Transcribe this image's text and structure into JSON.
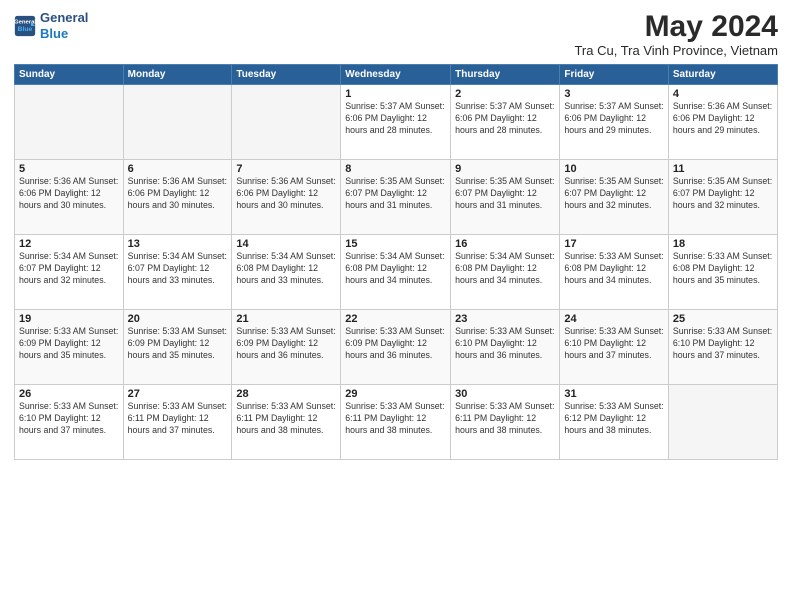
{
  "header": {
    "logo_line1": "General",
    "logo_line2": "Blue",
    "month_title": "May 2024",
    "subtitle": "Tra Cu, Tra Vinh Province, Vietnam"
  },
  "weekdays": [
    "Sunday",
    "Monday",
    "Tuesday",
    "Wednesday",
    "Thursday",
    "Friday",
    "Saturday"
  ],
  "weeks": [
    [
      {
        "day": "",
        "info": ""
      },
      {
        "day": "",
        "info": ""
      },
      {
        "day": "",
        "info": ""
      },
      {
        "day": "1",
        "info": "Sunrise: 5:37 AM\nSunset: 6:06 PM\nDaylight: 12 hours\nand 28 minutes."
      },
      {
        "day": "2",
        "info": "Sunrise: 5:37 AM\nSunset: 6:06 PM\nDaylight: 12 hours\nand 28 minutes."
      },
      {
        "day": "3",
        "info": "Sunrise: 5:37 AM\nSunset: 6:06 PM\nDaylight: 12 hours\nand 29 minutes."
      },
      {
        "day": "4",
        "info": "Sunrise: 5:36 AM\nSunset: 6:06 PM\nDaylight: 12 hours\nand 29 minutes."
      }
    ],
    [
      {
        "day": "5",
        "info": "Sunrise: 5:36 AM\nSunset: 6:06 PM\nDaylight: 12 hours\nand 30 minutes."
      },
      {
        "day": "6",
        "info": "Sunrise: 5:36 AM\nSunset: 6:06 PM\nDaylight: 12 hours\nand 30 minutes."
      },
      {
        "day": "7",
        "info": "Sunrise: 5:36 AM\nSunset: 6:06 PM\nDaylight: 12 hours\nand 30 minutes."
      },
      {
        "day": "8",
        "info": "Sunrise: 5:35 AM\nSunset: 6:07 PM\nDaylight: 12 hours\nand 31 minutes."
      },
      {
        "day": "9",
        "info": "Sunrise: 5:35 AM\nSunset: 6:07 PM\nDaylight: 12 hours\nand 31 minutes."
      },
      {
        "day": "10",
        "info": "Sunrise: 5:35 AM\nSunset: 6:07 PM\nDaylight: 12 hours\nand 32 minutes."
      },
      {
        "day": "11",
        "info": "Sunrise: 5:35 AM\nSunset: 6:07 PM\nDaylight: 12 hours\nand 32 minutes."
      }
    ],
    [
      {
        "day": "12",
        "info": "Sunrise: 5:34 AM\nSunset: 6:07 PM\nDaylight: 12 hours\nand 32 minutes."
      },
      {
        "day": "13",
        "info": "Sunrise: 5:34 AM\nSunset: 6:07 PM\nDaylight: 12 hours\nand 33 minutes."
      },
      {
        "day": "14",
        "info": "Sunrise: 5:34 AM\nSunset: 6:08 PM\nDaylight: 12 hours\nand 33 minutes."
      },
      {
        "day": "15",
        "info": "Sunrise: 5:34 AM\nSunset: 6:08 PM\nDaylight: 12 hours\nand 34 minutes."
      },
      {
        "day": "16",
        "info": "Sunrise: 5:34 AM\nSunset: 6:08 PM\nDaylight: 12 hours\nand 34 minutes."
      },
      {
        "day": "17",
        "info": "Sunrise: 5:33 AM\nSunset: 6:08 PM\nDaylight: 12 hours\nand 34 minutes."
      },
      {
        "day": "18",
        "info": "Sunrise: 5:33 AM\nSunset: 6:08 PM\nDaylight: 12 hours\nand 35 minutes."
      }
    ],
    [
      {
        "day": "19",
        "info": "Sunrise: 5:33 AM\nSunset: 6:09 PM\nDaylight: 12 hours\nand 35 minutes."
      },
      {
        "day": "20",
        "info": "Sunrise: 5:33 AM\nSunset: 6:09 PM\nDaylight: 12 hours\nand 35 minutes."
      },
      {
        "day": "21",
        "info": "Sunrise: 5:33 AM\nSunset: 6:09 PM\nDaylight: 12 hours\nand 36 minutes."
      },
      {
        "day": "22",
        "info": "Sunrise: 5:33 AM\nSunset: 6:09 PM\nDaylight: 12 hours\nand 36 minutes."
      },
      {
        "day": "23",
        "info": "Sunrise: 5:33 AM\nSunset: 6:10 PM\nDaylight: 12 hours\nand 36 minutes."
      },
      {
        "day": "24",
        "info": "Sunrise: 5:33 AM\nSunset: 6:10 PM\nDaylight: 12 hours\nand 37 minutes."
      },
      {
        "day": "25",
        "info": "Sunrise: 5:33 AM\nSunset: 6:10 PM\nDaylight: 12 hours\nand 37 minutes."
      }
    ],
    [
      {
        "day": "26",
        "info": "Sunrise: 5:33 AM\nSunset: 6:10 PM\nDaylight: 12 hours\nand 37 minutes."
      },
      {
        "day": "27",
        "info": "Sunrise: 5:33 AM\nSunset: 6:11 PM\nDaylight: 12 hours\nand 37 minutes."
      },
      {
        "day": "28",
        "info": "Sunrise: 5:33 AM\nSunset: 6:11 PM\nDaylight: 12 hours\nand 38 minutes."
      },
      {
        "day": "29",
        "info": "Sunrise: 5:33 AM\nSunset: 6:11 PM\nDaylight: 12 hours\nand 38 minutes."
      },
      {
        "day": "30",
        "info": "Sunrise: 5:33 AM\nSunset: 6:11 PM\nDaylight: 12 hours\nand 38 minutes."
      },
      {
        "day": "31",
        "info": "Sunrise: 5:33 AM\nSunset: 6:12 PM\nDaylight: 12 hours\nand 38 minutes."
      },
      {
        "day": "",
        "info": ""
      }
    ]
  ]
}
